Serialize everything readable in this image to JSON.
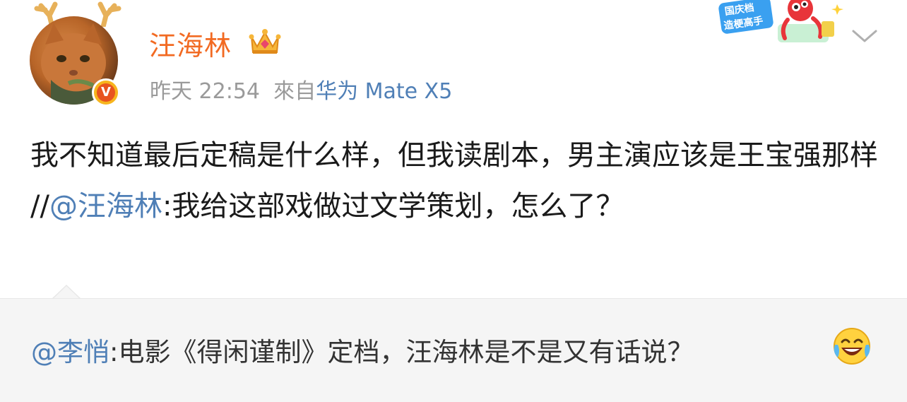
{
  "post": {
    "username": "汪海林",
    "time": "昨天 22:54",
    "source_prefix": "來自",
    "source_device": "华为 Mate X5",
    "promo_text_line1": "国庆档",
    "promo_text_line2": "造梗高手",
    "content_part1": "我不知道最后定稿是什么样，但我读剧本，男主演应该是王宝强那样 //",
    "content_mention": "@汪海林",
    "content_part2": ":我给这部戏做过文学策划，怎么了？"
  },
  "repost": {
    "mention": "@李悄",
    "text": ":电影《得闲谨制》定档，汪海林是不是又有话说？"
  },
  "icons": {
    "avatar": "cat-avatar",
    "verified": "verified-badge-icon",
    "crown": "crown-icon",
    "promo": "promo-sticker-icon",
    "dropdown": "chevron-down-icon",
    "emoji": "laughing-tears-emoji-icon"
  },
  "colors": {
    "username": "#f26a22",
    "link": "#4f7fb6",
    "meta": "#9a9a9a",
    "text": "#1a1a1a",
    "repost_bg": "#f5f5f5"
  },
  "badge_letter": "V"
}
